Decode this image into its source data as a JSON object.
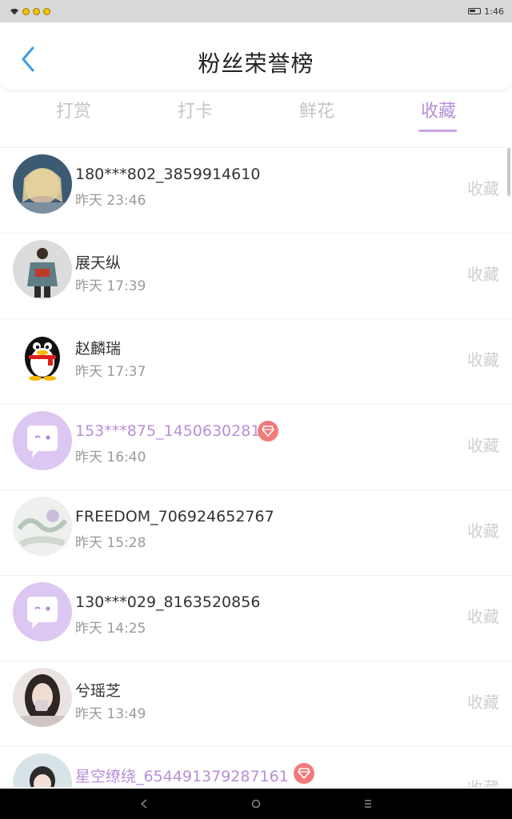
{
  "statusbar": {
    "time": "1:46"
  },
  "header": {
    "title": "粉丝荣誉榜"
  },
  "tabs": [
    {
      "label": "打赏"
    },
    {
      "label": "打卡"
    },
    {
      "label": "鲜花"
    },
    {
      "label": "收藏"
    }
  ],
  "active_tab": "收藏",
  "colors": {
    "accent": "#b98fd6",
    "badge": "#f07b7b",
    "muted": "#cfcfcf"
  },
  "fans": [
    {
      "name": "180***802_3859914610",
      "time": "昨天 23:46",
      "action": "收藏",
      "vip": false
    },
    {
      "name": "展天纵",
      "time": "昨天 17:39",
      "action": "收藏",
      "vip": false
    },
    {
      "name": "赵麟瑞",
      "time": "昨天 17:37",
      "action": "收藏",
      "vip": false
    },
    {
      "name": "153***875_1450630281",
      "time": "昨天 16:40",
      "action": "收藏",
      "vip": true
    },
    {
      "name": "FREEDOM_706924652767",
      "time": "昨天 15:28",
      "action": "收藏",
      "vip": false
    },
    {
      "name": "130***029_8163520856",
      "time": "昨天 14:25",
      "action": "收藏",
      "vip": false
    },
    {
      "name": "兮瑶芝",
      "time": "昨天 13:49",
      "action": "收藏",
      "vip": false
    },
    {
      "name": "星空缭绕_654491379287161",
      "time": "",
      "action": "收藏",
      "vip": true
    }
  ]
}
